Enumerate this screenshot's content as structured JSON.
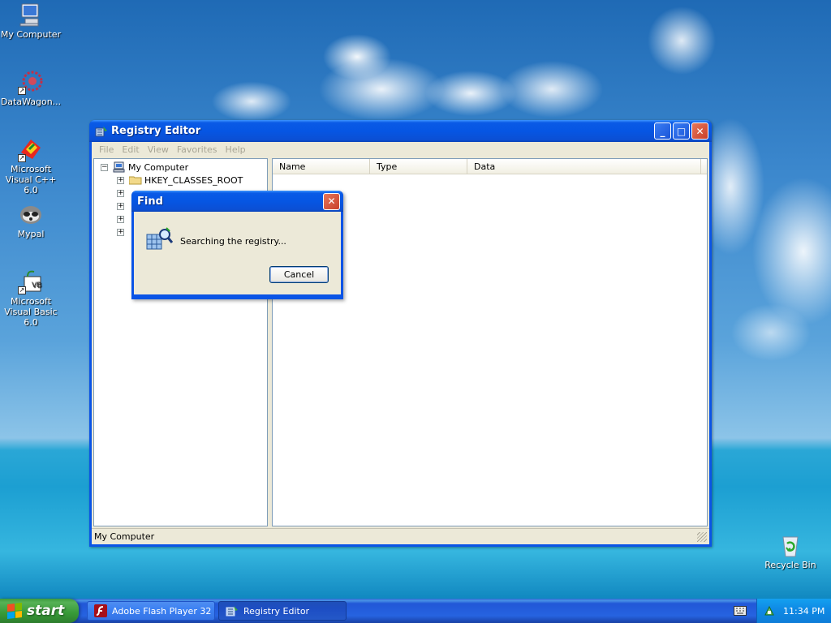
{
  "desktop": {
    "icons": [
      {
        "label": "My Computer",
        "icon": "computer-icon"
      },
      {
        "label": "DataWagon...",
        "icon": "datawagon-icon"
      },
      {
        "label": "Microsoft Visual C++ 6.0",
        "icon": "visual-cpp-icon"
      },
      {
        "label": "Mypal",
        "icon": "mypal-icon"
      },
      {
        "label": "Microsoft Visual Basic 6.0",
        "icon": "visual-basic-icon"
      },
      {
        "label": "Recycle Bin",
        "icon": "recycle-bin-icon"
      }
    ]
  },
  "regedit": {
    "title": "Registry Editor",
    "controls": {
      "minimize": "_",
      "maximize": "□",
      "close": "✕"
    },
    "menu": [
      "File",
      "Edit",
      "View",
      "Favorites",
      "Help"
    ],
    "tree": {
      "root": "My Computer",
      "children": [
        "HKEY_CLASSES_ROOT"
      ],
      "expander": "+",
      "root_expander": "−"
    },
    "columns": [
      "Name",
      "Type",
      "Data"
    ],
    "status": "My Computer"
  },
  "find_dialog": {
    "title": "Find",
    "message": "Searching the registry...",
    "cancel_label": "Cancel",
    "close_label": "✕"
  },
  "taskbar": {
    "start_label": "start",
    "tasks": [
      {
        "label": "Adobe Flash Player 32",
        "icon": "flash-player-icon",
        "active": false
      },
      {
        "label": "Registry Editor",
        "icon": "regedit-icon",
        "active": true
      }
    ],
    "clock": "11:34 PM"
  },
  "colors": {
    "title_blue": "#0a54e6",
    "start_green": "#3c9b3c",
    "window_bg": "#ece9d8",
    "close_red": "#c8402a"
  }
}
